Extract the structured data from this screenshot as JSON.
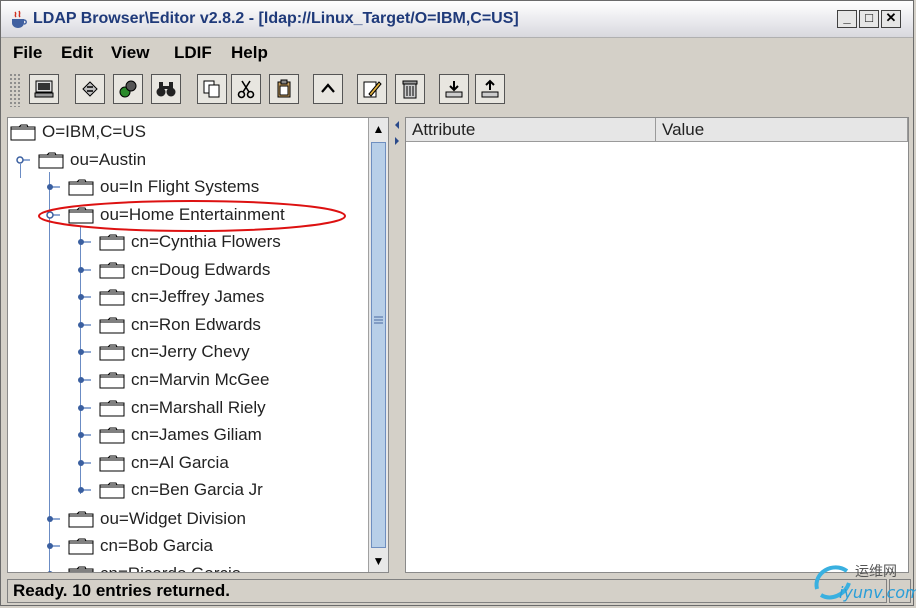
{
  "window": {
    "title": "LDAP Browser\\Editor v2.8.2 - [ldap://Linux_Target/O=IBM,C=US]",
    "min_glyph": "_",
    "max_glyph": "□",
    "close_glyph": "✕"
  },
  "menu": [
    "File",
    "Edit",
    "View",
    "LDIF",
    "Help"
  ],
  "toolbar": {
    "buttons": [
      "computer-icon",
      "refresh-icon",
      "connect-icon",
      "binoculars-icon",
      "copy-icon",
      "cut-icon",
      "paste-icon",
      "up-icon",
      "edit-icon",
      "delete-icon",
      "import-icon",
      "export-icon"
    ]
  },
  "tree": {
    "root": "O=IBM,C=US",
    "austin": "ou=Austin",
    "in_flight": "ou=In Flight Systems",
    "home_ent": "ou=Home Entertainment",
    "people": [
      "cn=Cynthia Flowers",
      "cn=Doug Edwards",
      "cn=Jeffrey James",
      "cn=Ron Edwards",
      "cn=Jerry Chevy",
      "cn=Marvin McGee",
      "cn=Marshall Riely",
      "cn=James Giliam",
      "cn=Al Garcia",
      "cn=Ben Garcia Jr"
    ],
    "widget": "ou=Widget Division",
    "bob": "cn=Bob Garcia",
    "ricardo": "cn=Ricardo Garcia",
    "highlight_color": "#dd1111"
  },
  "table": {
    "columns": [
      "Attribute",
      "Value"
    ]
  },
  "status": {
    "text": "Ready. 10 entries returned."
  },
  "watermark": {
    "line1": "运维网",
    "line2": "iyunv.com"
  }
}
